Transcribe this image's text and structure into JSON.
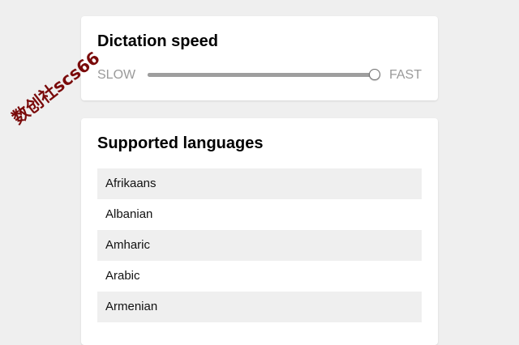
{
  "speed_card": {
    "title": "Dictation speed",
    "slow_label": "SLOW",
    "fast_label": "FAST",
    "slider_value": 1.0
  },
  "languages_card": {
    "title": "Supported languages",
    "items": [
      {
        "label": "Afrikaans"
      },
      {
        "label": "Albanian"
      },
      {
        "label": "Amharic"
      },
      {
        "label": "Arabic"
      },
      {
        "label": "Armenian"
      }
    ]
  },
  "watermark": {
    "text": "数创社scs66"
  },
  "colors": {
    "page_background": "#efefef",
    "card_background": "#ffffff",
    "row_shade": "#efefef",
    "label_muted": "#9a9a9a",
    "watermark": "#7a0a0a"
  }
}
